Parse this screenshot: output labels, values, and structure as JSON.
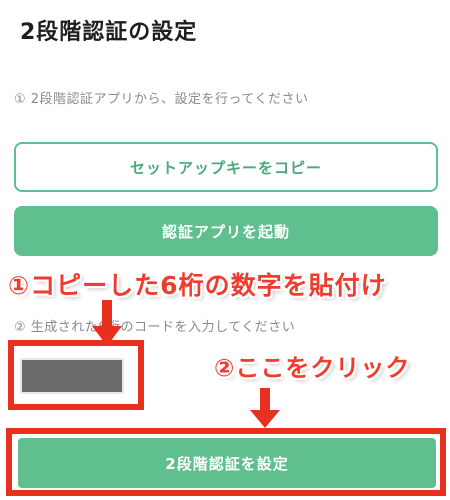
{
  "page": {
    "title": "2段階認証の設定"
  },
  "step1": {
    "text": "① 2段階認証アプリから、設定を行ってください",
    "copy_button_label": "セットアップキーをコピー",
    "launch_button_label": "認証アプリを起動"
  },
  "step2": {
    "text": "② 生成された6桁のコードを入力してください",
    "code_value": ""
  },
  "submit": {
    "label": "2段階認証を設定"
  },
  "annotations": {
    "paste_instruction": "①コピーした6桁の数字を貼付け",
    "click_instruction": "②ここをクリック"
  },
  "colors": {
    "accent_green": "#5fbf8e",
    "annotation_red": "#f03c2e"
  }
}
